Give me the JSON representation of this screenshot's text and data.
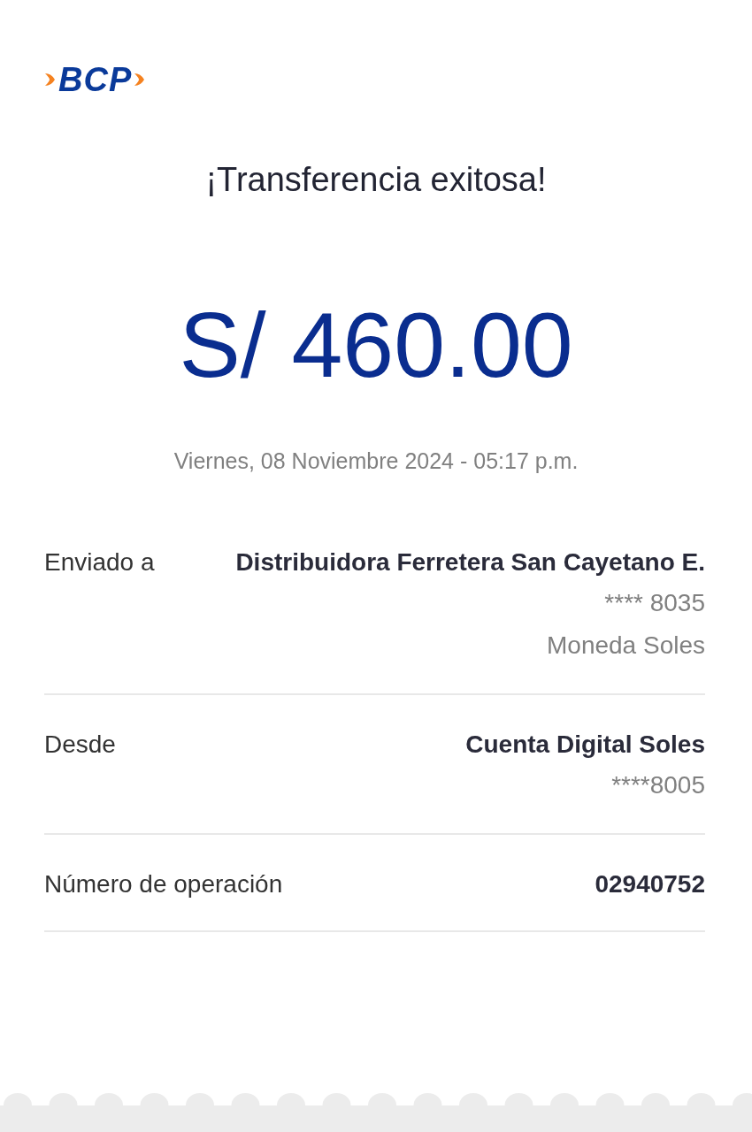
{
  "logo": {
    "text": "BCP"
  },
  "title": "¡Transferencia exitosa!",
  "amount": "S/ 460.00",
  "datetime": "Viernes, 08 Noviembre 2024 - 05:17 p.m.",
  "details": [
    {
      "label": "Enviado a",
      "values": [
        {
          "kind": "main",
          "text": "Distribuidora Ferretera San Cayetano E."
        },
        {
          "kind": "detail",
          "text": "**** 8035"
        },
        {
          "kind": "detail",
          "text": "Moneda Soles"
        }
      ]
    },
    {
      "label": "Desde",
      "values": [
        {
          "kind": "main",
          "text": "Cuenta Digital Soles"
        },
        {
          "kind": "detail",
          "text": "****8005"
        }
      ]
    },
    {
      "label": "Número de operación",
      "values": [
        {
          "kind": "main",
          "text": "02940752"
        }
      ]
    }
  ]
}
